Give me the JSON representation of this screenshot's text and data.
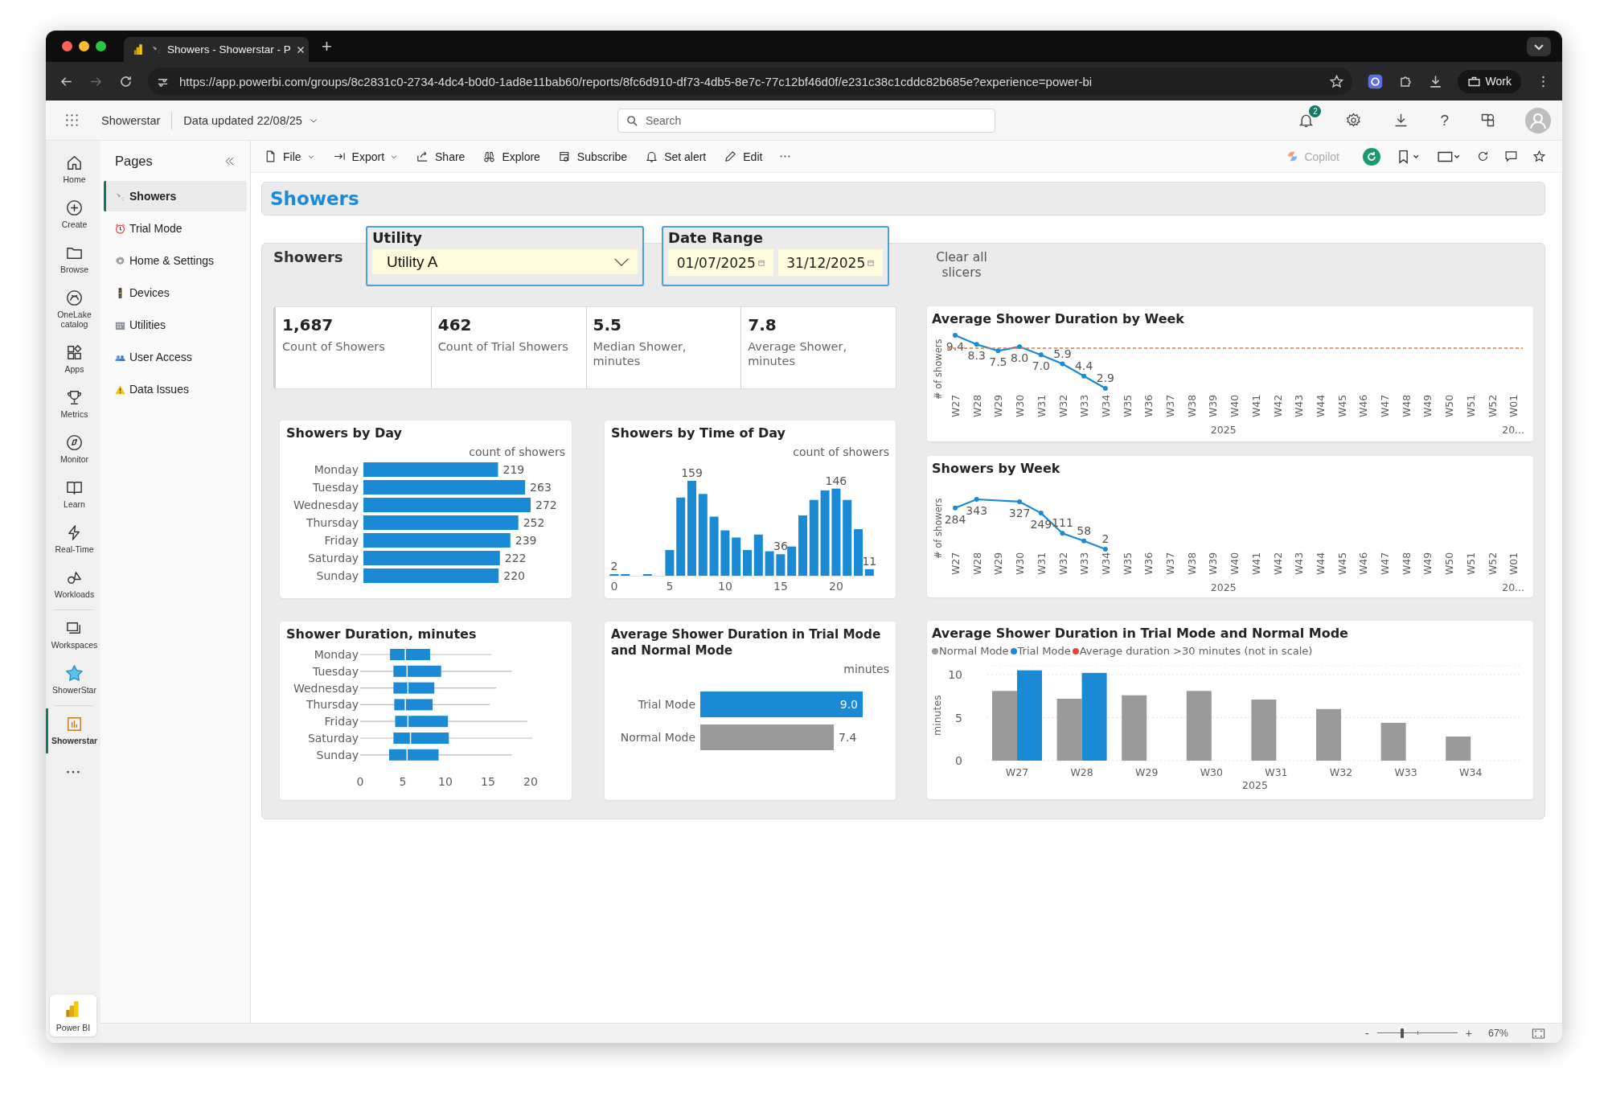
{
  "browser": {
    "tabs": [
      {
        "title": "Showers - Showerstar - P",
        "selected": true
      }
    ],
    "new_tab": "+",
    "url": "https://app.powerbi.com/groups/8c2831c0-2734-4dc4-b0d0-1ad8e11bab60/reports/8fc6d910-df73-4db5-8e7c-77c12bf46d0f/e231c38c1cddc82b685e?experience=power-bi",
    "profile": "Work"
  },
  "app_header": {
    "workspace": "Showerstar",
    "data_updated": "Data updated 22/08/25",
    "search": {
      "placeholder": "Search"
    },
    "notification_count": "2",
    "help": "?"
  },
  "nav_rail": {
    "groups": [
      {
        "items": [
          {
            "label": "Home",
            "kind": "home",
            "selected": false
          },
          {
            "label": "Create",
            "kind": "create",
            "selected": false
          },
          {
            "label": "Browse",
            "kind": "browse",
            "selected": false
          },
          {
            "label": "OneLake catalog",
            "kind": "onelake",
            "selected": false
          },
          {
            "label": "Apps",
            "kind": "apps",
            "selected": false
          },
          {
            "label": "Metrics",
            "kind": "metrics",
            "selected": false
          },
          {
            "label": "Monitor",
            "kind": "monitor",
            "selected": false
          },
          {
            "label": "Learn",
            "kind": "learn",
            "selected": false
          },
          {
            "label": "Real-Time",
            "kind": "realtime",
            "selected": false
          },
          {
            "label": "Workloads",
            "kind": "workloads",
            "selected": false
          }
        ]
      },
      {
        "items": [
          {
            "label": "Workspaces",
            "kind": "workspaces",
            "selected": false
          },
          {
            "label": "ShowerStar",
            "kind": "mascot",
            "selected": false
          }
        ]
      },
      {
        "items": [
          {
            "label": "Showerstar",
            "kind": "report",
            "selected": true
          }
        ]
      }
    ],
    "footer": "Power BI"
  },
  "toolbar": {
    "items": [
      {
        "label": "File",
        "kind": "file",
        "dropdown": true
      },
      {
        "label": "Export",
        "kind": "export",
        "dropdown": true
      },
      {
        "label": "Share",
        "kind": "share",
        "dropdown": false
      },
      {
        "label": "Explore",
        "kind": "explore",
        "dropdown": false
      },
      {
        "label": "Subscribe",
        "kind": "subscribe",
        "dropdown": false
      },
      {
        "label": "Set alert",
        "kind": "alert",
        "dropdown": false
      },
      {
        "label": "Edit",
        "kind": "edit",
        "dropdown": false
      }
    ],
    "copilot": {
      "label": "Copilot",
      "disabled": true
    }
  },
  "pages": {
    "title": "Pages",
    "items": [
      {
        "label": "Showers",
        "kind": "shower",
        "selected": true
      },
      {
        "label": "Trial Mode",
        "kind": "alarm",
        "selected": false
      },
      {
        "label": "Home & Settings",
        "kind": "gear",
        "selected": false
      },
      {
        "label": "Devices",
        "kind": "traffic",
        "selected": false
      },
      {
        "label": "Utilities",
        "kind": "building",
        "selected": false
      },
      {
        "label": "User Access",
        "kind": "people",
        "selected": false
      },
      {
        "label": "Data Issues",
        "kind": "warning",
        "selected": false
      }
    ]
  },
  "report": {
    "title": "Showers",
    "section_label": "Showers",
    "slicers": [
      {
        "kind": "dropdown",
        "title": "Utility",
        "values": [
          "Utility A"
        ]
      },
      {
        "kind": "date-range",
        "title": "Date Range",
        "values": [
          "01/07/2025",
          "31/12/2025"
        ]
      }
    ],
    "clear_button": "Clear all slicers",
    "kpis": [
      {
        "value": "1,687",
        "label": "Count of Showers"
      },
      {
        "value": "462",
        "label": "Count of Trial Showers"
      },
      {
        "value": "5.5",
        "label": "Median Shower, minutes"
      },
      {
        "value": "7.8",
        "label": "Average Shower, minutes"
      }
    ],
    "showers_by_day": {
      "chart_data": {
        "type": "bar",
        "title": "Showers by Day",
        "orientation": "horizontal",
        "xlabel": "count of showers",
        "categories": [
          "Monday",
          "Tuesday",
          "Wednesday",
          "Thursday",
          "Friday",
          "Saturday",
          "Sunday"
        ],
        "values": [
          219,
          263,
          272,
          252,
          239,
          222,
          220
        ],
        "value_labels": [
          "219",
          "263",
          "272",
          "252",
          "239",
          "222",
          "220"
        ]
      }
    },
    "showers_by_time_of_day": {
      "chart_data": {
        "type": "bar",
        "title": "Showers by Time of Day",
        "ylabel": "count of showers",
        "x": [
          0,
          1,
          2,
          3,
          4,
          5,
          6,
          7,
          8,
          9,
          10,
          11,
          12,
          13,
          14,
          15,
          16,
          17,
          18,
          19,
          20,
          21,
          22,
          23
        ],
        "values": [
          2,
          2,
          null,
          1,
          null,
          43,
          131,
          159,
          137,
          99,
          76,
          64,
          43,
          69,
          41,
          36,
          49,
          101,
          127,
          143,
          146,
          127,
          78,
          11
        ],
        "value_labels": [
          "2",
          null,
          null,
          null,
          null,
          null,
          null,
          "159",
          null,
          null,
          null,
          null,
          null,
          null,
          null,
          "36",
          null,
          null,
          null,
          null,
          "146",
          null,
          null,
          "11"
        ],
        "xlim": [
          -0.5,
          23.5
        ],
        "xticks": [
          0,
          5,
          10,
          15,
          20
        ]
      }
    },
    "shower_duration": {
      "title": "Shower Duration, minutes",
      "categories": [
        "Monday",
        "Tuesday",
        "Wednesday",
        "Thursday",
        "Friday",
        "Saturday",
        "Sunday"
      ],
      "xticks": [
        "0",
        "5",
        "10",
        "15",
        "20"
      ]
    },
    "trial_vs_normal": {
      "chart_data": {
        "type": "bar",
        "title": "Average Shower Duration in Trial Mode and Normal Mode",
        "orientation": "horizontal",
        "xlabel": "minutes",
        "categories": [
          "Trial Mode",
          "Normal Mode"
        ],
        "values": [
          9.0,
          7.4
        ],
        "colors": [
          "#1a8ad4",
          "#9a9a9a"
        ],
        "value_labels": [
          "9.0",
          "7.4"
        ]
      }
    },
    "weekly_charts": [
      {
        "year_labels": [
          "2025",
          "20..."
        ],
        "chart_data": {
          "type": "line",
          "title": "Average Shower Duration by Week",
          "ylabel": "# of showers",
          "categories": [
            "W27",
            "W28",
            "W29",
            "W30",
            "W31",
            "W32",
            "W33",
            "W34",
            "W35",
            "W36",
            "W37",
            "W38",
            "W39",
            "W40",
            "W41",
            "W42",
            "W43",
            "W44",
            "W45",
            "W46",
            "W47",
            "W48",
            "W49",
            "W50",
            "W51",
            "W52",
            "W01"
          ],
          "marker": "circle",
          "values": [
            9.4,
            8.3,
            7.5,
            8.0,
            7.0,
            5.9,
            4.4,
            2.9,
            null,
            null,
            null,
            null,
            null,
            null,
            null,
            null,
            null,
            null,
            null,
            null,
            null,
            null,
            null,
            null,
            null,
            null,
            null
          ],
          "value_labels": [
            "9.4",
            "8.3",
            "7.5",
            "8.0",
            "7.0",
            "5.9",
            "4.4",
            "2.9",
            null,
            null,
            null,
            null,
            null,
            null,
            null,
            null,
            null,
            null,
            null,
            null,
            null,
            null,
            null,
            null,
            null,
            null,
            null
          ]
        },
        "average_line": true
      },
      {
        "year_labels": [
          "2025",
          "20..."
        ],
        "chart_data": {
          "type": "line",
          "title": "Showers by Week",
          "ylabel": "# of showers",
          "categories": [
            "W27",
            "W28",
            "W29",
            "W30",
            "W31",
            "W32",
            "W33",
            "W34",
            "W35",
            "W36",
            "W37",
            "W38",
            "W39",
            "W40",
            "W41",
            "W42",
            "W43",
            "W44",
            "W45",
            "W46",
            "W47",
            "W48",
            "W49",
            "W50",
            "W51",
            "W52",
            "W01"
          ],
          "marker": "circle",
          "values": [
            284,
            343,
            null,
            327,
            249,
            111,
            58,
            2,
            null,
            null,
            null,
            null,
            null,
            null,
            null,
            null,
            null,
            null,
            null,
            null,
            null,
            null,
            null,
            null,
            null,
            null,
            null
          ],
          "value_labels": [
            "284",
            "343",
            null,
            "327",
            "249",
            "111",
            "58",
            "2",
            null,
            null,
            null,
            null,
            null,
            null,
            null,
            null,
            null,
            null,
            null,
            null,
            null,
            null,
            null,
            null,
            null,
            null,
            null
          ]
        },
        "average_line": false
      }
    ],
    "avg_duration_trial_normal": {
      "chart_data": {
        "type": "bar",
        "title": "Average Shower Duration in Trial Mode and Normal Mode",
        "xlabel": "2025",
        "ylabel": "minutes",
        "categories": [
          "W27",
          "W28",
          "W29",
          "W30",
          "W31",
          "W32",
          "W33",
          "W34"
        ],
        "series": [
          {
            "name": "Normal Mode",
            "color": "#9a9a9a",
            "values": [
              8.1,
              7.2,
              7.6,
              8.1,
              7.1,
              6.0,
              4.4,
              2.8
            ]
          },
          {
            "name": "Trial Mode",
            "color": "#1a8ad4",
            "values": [
              10.5,
              10.2,
              null,
              null,
              null,
              null,
              null,
              null
            ]
          },
          {
            "name": "Average duration >30 minutes (not in scale)",
            "color": "#e2493c",
            "values": [
              null,
              null,
              null,
              null,
              null,
              null,
              null,
              null
            ]
          }
        ],
        "ylim": [
          0,
          11
        ],
        "yticks": [
          0,
          5,
          10
        ]
      }
    }
  },
  "status_bar": {
    "zoom_out": "-",
    "zoom_in": "+",
    "zoom": "67%",
    "zoom_slider": {
      "level": 0.31
    }
  }
}
